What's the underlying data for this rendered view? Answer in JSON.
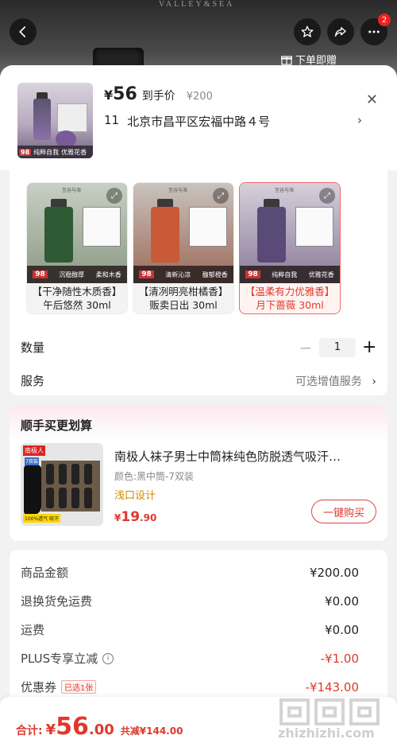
{
  "hero": {
    "brand_text": "VALLEY&SEA",
    "order_gift_label": "下单即赠",
    "notification_count": "2"
  },
  "header": {
    "currency": "¥",
    "price": "56",
    "price_tag": "到手价",
    "original_price": "¥200",
    "address_index": "11",
    "address": "北京市昌平区宏福中路４号"
  },
  "thumb": {
    "brand": "至谷与海",
    "price_chip": "98",
    "tagline_1": "纯粹自我",
    "tagline_2": "优雅花香"
  },
  "variants": [
    {
      "label": "【干净随性木质香】午后悠然 30ml",
      "line1": "【干净随性木质香】",
      "line2": "午后悠然 30ml",
      "price_chip": "98",
      "strip_1": "沉稳醇厚",
      "strip_2": "柔和木香",
      "selected": false,
      "bottle_color": "#2e5a34"
    },
    {
      "label": "【清冽明亮柑橘香】贩卖日出 30ml",
      "line1": "【清冽明亮柑橘香】",
      "line2": "贩卖日出 30ml",
      "price_chip": "98",
      "strip_1": "清新沁凉",
      "strip_2": "馥郁橙香",
      "selected": false,
      "bottle_color": "#c85a38"
    },
    {
      "label": "【温柔有力优雅香】月下蔷薇 30ml",
      "line1": "【温柔有力优雅香】",
      "line2": "月下蔷薇 30ml",
      "price_chip": "98",
      "strip_1": "纯粹自我",
      "strip_2": "优雅花香",
      "selected": true,
      "bottle_color": "#5a4a78"
    }
  ],
  "variant_brand": "至谷与海",
  "quantity": {
    "label": "数量",
    "value": "1"
  },
  "service": {
    "label": "服务",
    "option_text": "可选增值服务"
  },
  "bundle": {
    "title": "顺手买更划算",
    "product_name": "南极人袜子男士中筒袜纯色防脱透气吸汗…",
    "spec": "颜色:黑中筒-7双装",
    "feature": "浅口设计",
    "price_yen": "¥",
    "price_int": "19",
    "price_dec": ".90",
    "buy_label": "一键购买",
    "img_brand": "南极人",
    "img_tag": "7双装",
    "img_bottom": "100%透气 吸汗"
  },
  "details": {
    "rows": [
      {
        "label": "商品金额",
        "value": "¥200.00"
      },
      {
        "label": "退换货免运费",
        "value": "¥0.00"
      },
      {
        "label": "运费",
        "value": "¥0.00"
      },
      {
        "label": "PLUS专享立减",
        "value": "-¥1.00"
      },
      {
        "label": "优惠券",
        "value": "-¥143.00"
      }
    ],
    "coupon_chip": "已选1张"
  },
  "footer": {
    "total_label": "合计:",
    "total_yen": "¥",
    "total_int": "56",
    "total_dec": ".00",
    "savings": "共减¥144.00",
    "watermark_text": "zhizhizhi.com"
  },
  "colors": {
    "accent": "#e0382c",
    "coupon_orange": "#d08a00"
  }
}
